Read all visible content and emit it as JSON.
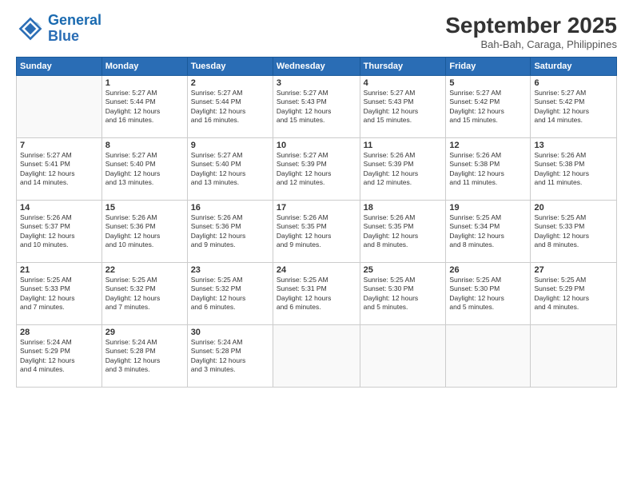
{
  "header": {
    "logo_line1": "General",
    "logo_line2": "Blue",
    "month": "September 2025",
    "location": "Bah-Bah, Caraga, Philippines"
  },
  "weekdays": [
    "Sunday",
    "Monday",
    "Tuesday",
    "Wednesday",
    "Thursday",
    "Friday",
    "Saturday"
  ],
  "weeks": [
    [
      {
        "day": "",
        "info": ""
      },
      {
        "day": "1",
        "info": "Sunrise: 5:27 AM\nSunset: 5:44 PM\nDaylight: 12 hours\nand 16 minutes."
      },
      {
        "day": "2",
        "info": "Sunrise: 5:27 AM\nSunset: 5:44 PM\nDaylight: 12 hours\nand 16 minutes."
      },
      {
        "day": "3",
        "info": "Sunrise: 5:27 AM\nSunset: 5:43 PM\nDaylight: 12 hours\nand 15 minutes."
      },
      {
        "day": "4",
        "info": "Sunrise: 5:27 AM\nSunset: 5:43 PM\nDaylight: 12 hours\nand 15 minutes."
      },
      {
        "day": "5",
        "info": "Sunrise: 5:27 AM\nSunset: 5:42 PM\nDaylight: 12 hours\nand 15 minutes."
      },
      {
        "day": "6",
        "info": "Sunrise: 5:27 AM\nSunset: 5:42 PM\nDaylight: 12 hours\nand 14 minutes."
      }
    ],
    [
      {
        "day": "7",
        "info": "Sunrise: 5:27 AM\nSunset: 5:41 PM\nDaylight: 12 hours\nand 14 minutes."
      },
      {
        "day": "8",
        "info": "Sunrise: 5:27 AM\nSunset: 5:40 PM\nDaylight: 12 hours\nand 13 minutes."
      },
      {
        "day": "9",
        "info": "Sunrise: 5:27 AM\nSunset: 5:40 PM\nDaylight: 12 hours\nand 13 minutes."
      },
      {
        "day": "10",
        "info": "Sunrise: 5:27 AM\nSunset: 5:39 PM\nDaylight: 12 hours\nand 12 minutes."
      },
      {
        "day": "11",
        "info": "Sunrise: 5:26 AM\nSunset: 5:39 PM\nDaylight: 12 hours\nand 12 minutes."
      },
      {
        "day": "12",
        "info": "Sunrise: 5:26 AM\nSunset: 5:38 PM\nDaylight: 12 hours\nand 11 minutes."
      },
      {
        "day": "13",
        "info": "Sunrise: 5:26 AM\nSunset: 5:38 PM\nDaylight: 12 hours\nand 11 minutes."
      }
    ],
    [
      {
        "day": "14",
        "info": "Sunrise: 5:26 AM\nSunset: 5:37 PM\nDaylight: 12 hours\nand 10 minutes."
      },
      {
        "day": "15",
        "info": "Sunrise: 5:26 AM\nSunset: 5:36 PM\nDaylight: 12 hours\nand 10 minutes."
      },
      {
        "day": "16",
        "info": "Sunrise: 5:26 AM\nSunset: 5:36 PM\nDaylight: 12 hours\nand 9 minutes."
      },
      {
        "day": "17",
        "info": "Sunrise: 5:26 AM\nSunset: 5:35 PM\nDaylight: 12 hours\nand 9 minutes."
      },
      {
        "day": "18",
        "info": "Sunrise: 5:26 AM\nSunset: 5:35 PM\nDaylight: 12 hours\nand 8 minutes."
      },
      {
        "day": "19",
        "info": "Sunrise: 5:25 AM\nSunset: 5:34 PM\nDaylight: 12 hours\nand 8 minutes."
      },
      {
        "day": "20",
        "info": "Sunrise: 5:25 AM\nSunset: 5:33 PM\nDaylight: 12 hours\nand 8 minutes."
      }
    ],
    [
      {
        "day": "21",
        "info": "Sunrise: 5:25 AM\nSunset: 5:33 PM\nDaylight: 12 hours\nand 7 minutes."
      },
      {
        "day": "22",
        "info": "Sunrise: 5:25 AM\nSunset: 5:32 PM\nDaylight: 12 hours\nand 7 minutes."
      },
      {
        "day": "23",
        "info": "Sunrise: 5:25 AM\nSunset: 5:32 PM\nDaylight: 12 hours\nand 6 minutes."
      },
      {
        "day": "24",
        "info": "Sunrise: 5:25 AM\nSunset: 5:31 PM\nDaylight: 12 hours\nand 6 minutes."
      },
      {
        "day": "25",
        "info": "Sunrise: 5:25 AM\nSunset: 5:30 PM\nDaylight: 12 hours\nand 5 minutes."
      },
      {
        "day": "26",
        "info": "Sunrise: 5:25 AM\nSunset: 5:30 PM\nDaylight: 12 hours\nand 5 minutes."
      },
      {
        "day": "27",
        "info": "Sunrise: 5:25 AM\nSunset: 5:29 PM\nDaylight: 12 hours\nand 4 minutes."
      }
    ],
    [
      {
        "day": "28",
        "info": "Sunrise: 5:24 AM\nSunset: 5:29 PM\nDaylight: 12 hours\nand 4 minutes."
      },
      {
        "day": "29",
        "info": "Sunrise: 5:24 AM\nSunset: 5:28 PM\nDaylight: 12 hours\nand 3 minutes."
      },
      {
        "day": "30",
        "info": "Sunrise: 5:24 AM\nSunset: 5:28 PM\nDaylight: 12 hours\nand 3 minutes."
      },
      {
        "day": "",
        "info": ""
      },
      {
        "day": "",
        "info": ""
      },
      {
        "day": "",
        "info": ""
      },
      {
        "day": "",
        "info": ""
      }
    ]
  ]
}
